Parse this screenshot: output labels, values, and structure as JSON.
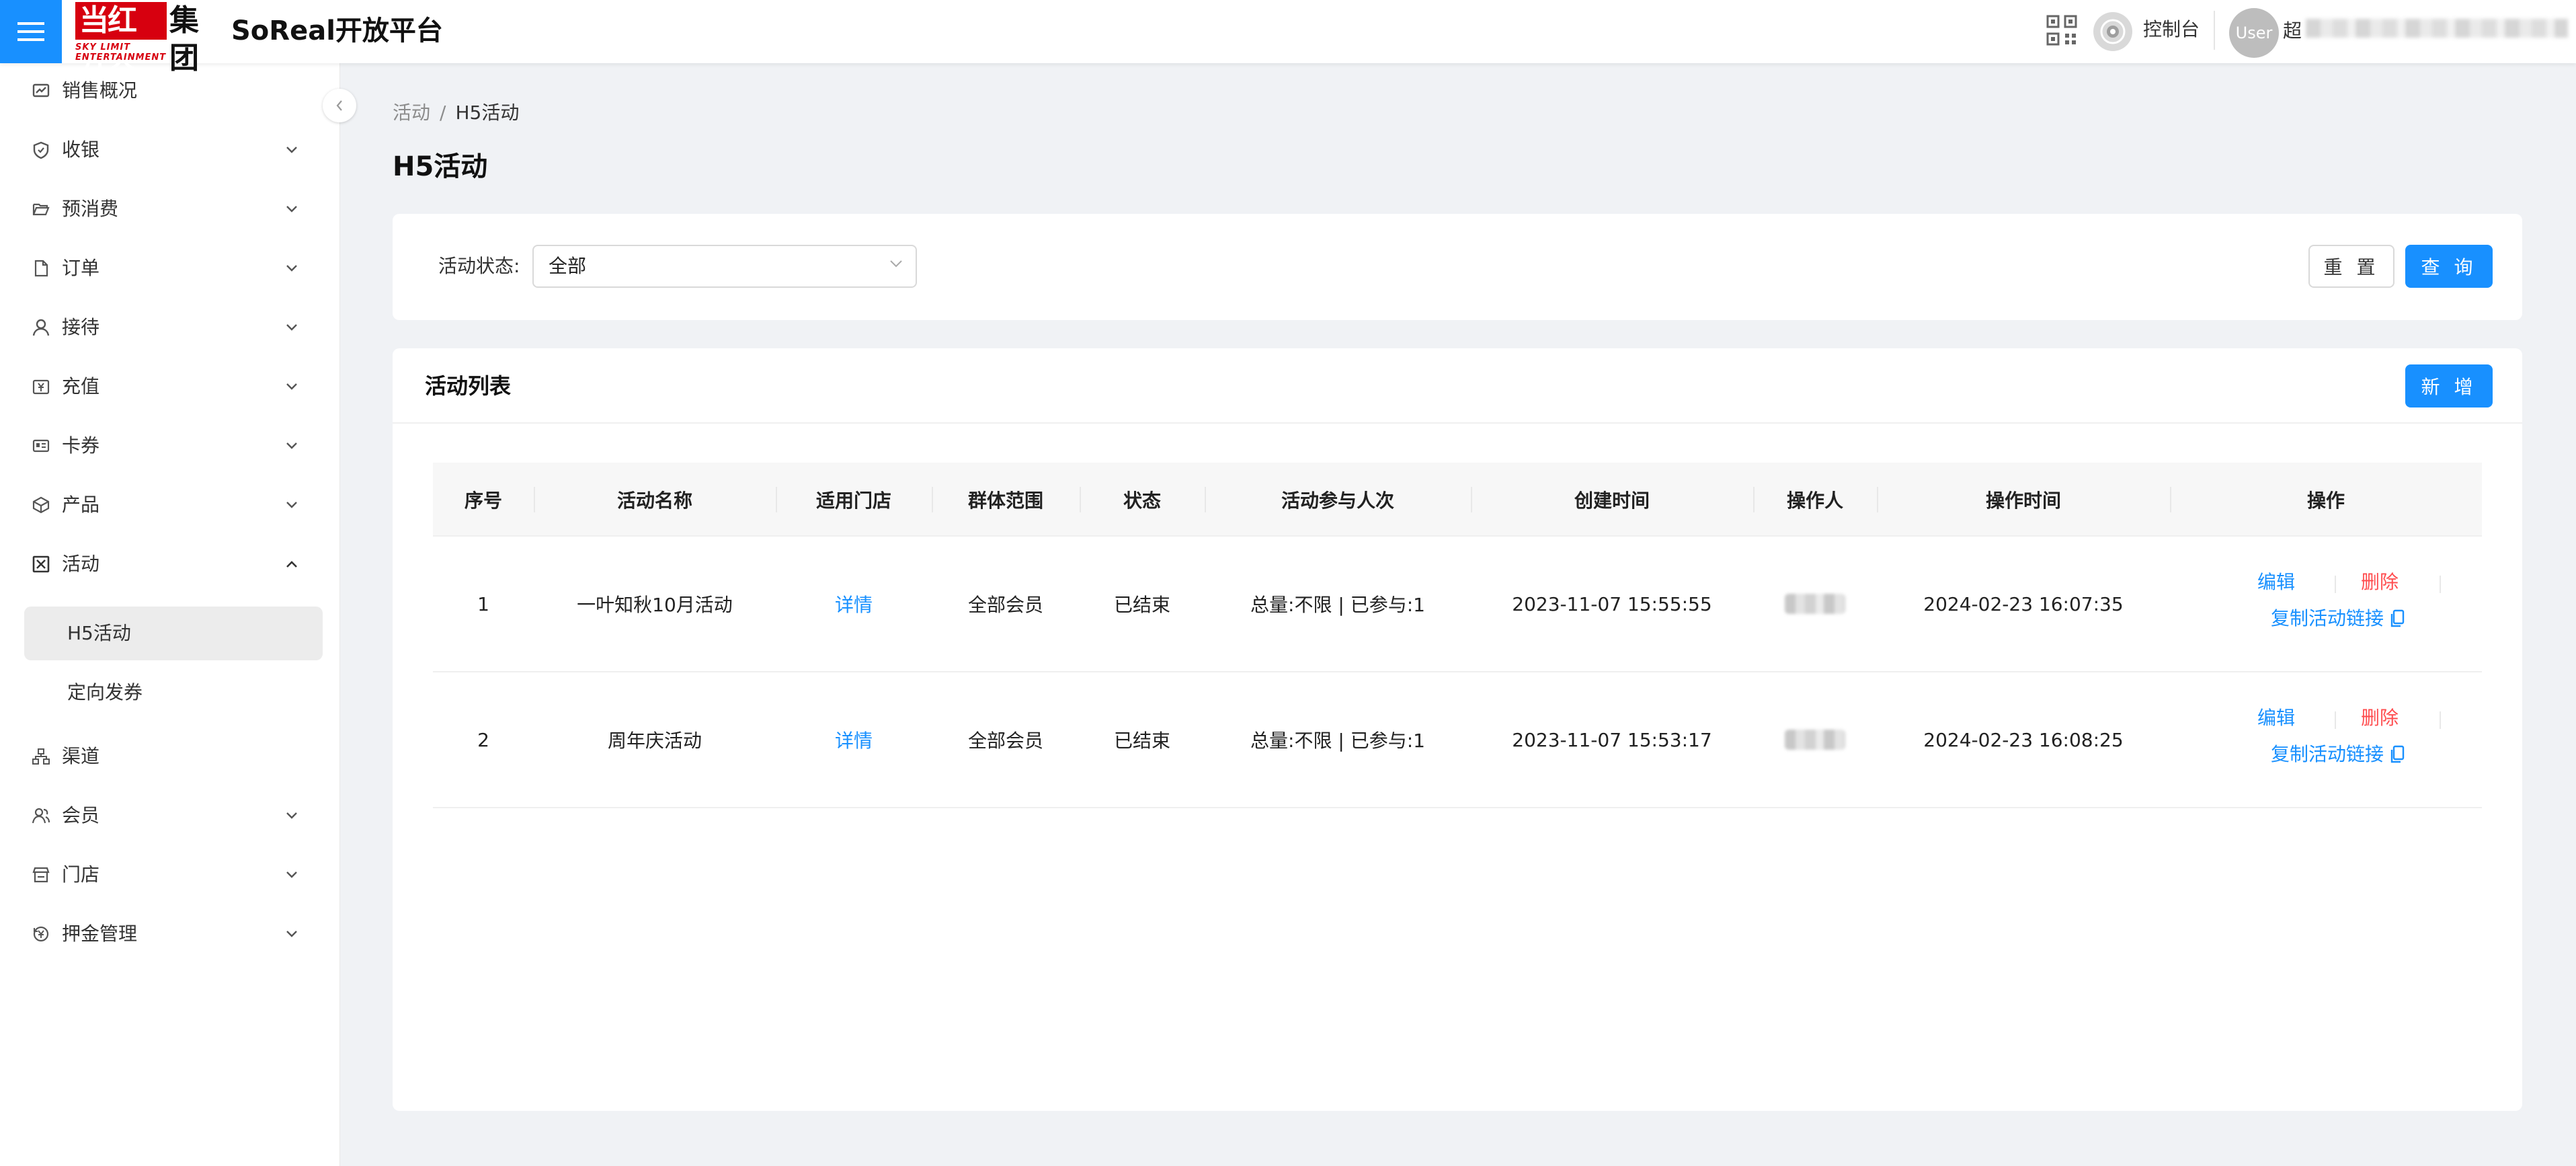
{
  "header": {
    "logo_main": "当红齐天",
    "logo_side": "集团",
    "logo_tagline": "SKY LIMIT ENTERTAINMENT",
    "app_title": "SoReal开放平台",
    "console_label": "控制台",
    "avatar_text": "User",
    "user_name_visible": "超"
  },
  "sidebar": {
    "items": [
      {
        "label": "销售概况",
        "icon": "chart-card-icon",
        "expandable": false
      },
      {
        "label": "收银",
        "icon": "shield-icon",
        "expandable": true
      },
      {
        "label": "预消费",
        "icon": "folder-open-icon",
        "expandable": true
      },
      {
        "label": "订单",
        "icon": "file-icon",
        "expandable": true
      },
      {
        "label": "接待",
        "icon": "user-icon",
        "expandable": true
      },
      {
        "label": "充值",
        "icon": "yen-card-icon",
        "expandable": true
      },
      {
        "label": "卡券",
        "icon": "id-card-icon",
        "expandable": true
      },
      {
        "label": "产品",
        "icon": "cube-icon",
        "expandable": true
      },
      {
        "label": "活动",
        "icon": "activity-box-icon",
        "expandable": true,
        "expanded": true
      },
      {
        "label": "渠道",
        "icon": "channel-tree-icon",
        "expandable": false
      },
      {
        "label": "会员",
        "icon": "members-icon",
        "expandable": true
      },
      {
        "label": "门店",
        "icon": "store-icon",
        "expandable": true
      },
      {
        "label": "押金管理",
        "icon": "deposit-icon",
        "expandable": true
      }
    ],
    "sub_items": [
      {
        "label": "H5活动",
        "active": true
      },
      {
        "label": "定向发券",
        "active": false
      }
    ]
  },
  "breadcrumb": {
    "parent": "活动",
    "separator": "/",
    "current": "H5活动"
  },
  "page_title": "H5活动",
  "filter": {
    "status_label": "活动状态:",
    "status_value": "全部",
    "reset_label": "重 置",
    "query_label": "查 询"
  },
  "list": {
    "title": "活动列表",
    "add_label": "新 增",
    "columns": [
      "序号",
      "活动名称",
      "适用门店",
      "群体范围",
      "状态",
      "活动参与人次",
      "创建时间",
      "操作人",
      "操作时间",
      "操作"
    ],
    "rows": [
      {
        "index": "1",
        "name": "一叶知秋10月活动",
        "stores": "详情",
        "scope": "全部会员",
        "status": "已结束",
        "participation": "总量:不限 | 已参与:1",
        "created": "2023-11-07 15:55:55",
        "operated": "2024-02-23 16:07:35",
        "edit": "编辑",
        "delete": "删除",
        "copy_link": "复制活动链接"
      },
      {
        "index": "2",
        "name": "周年庆活动",
        "stores": "详情",
        "scope": "全部会员",
        "status": "已结束",
        "participation": "总量:不限 | 已参与:1",
        "created": "2023-11-07 15:53:17",
        "operated": "2024-02-23 16:08:25",
        "edit": "编辑",
        "delete": "删除",
        "copy_link": "复制活动链接"
      }
    ]
  },
  "colors": {
    "primary": "#1890ff",
    "danger": "#ff4d4f",
    "logo_red": "#d7000f",
    "page_bg": "#f0f2f5"
  }
}
